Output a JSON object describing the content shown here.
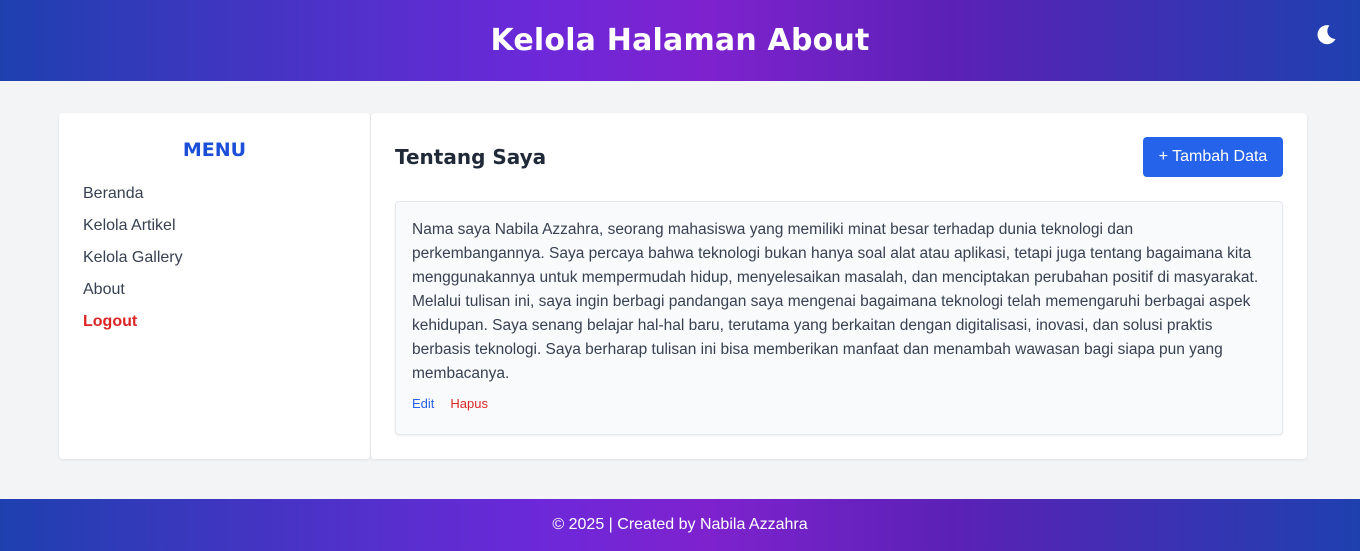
{
  "header": {
    "title": "Kelola Halaman About",
    "theme_icon": "moon-icon"
  },
  "sidebar": {
    "heading": "MENU",
    "items": [
      {
        "label": "Beranda"
      },
      {
        "label": "Kelola Artikel"
      },
      {
        "label": "Kelola Gallery"
      },
      {
        "label": "About"
      },
      {
        "label": "Logout"
      }
    ]
  },
  "main": {
    "title": "Tentang Saya",
    "add_button": "+ Tambah Data",
    "entry": {
      "text": "Nama saya Nabila Azzahra, seorang mahasiswa yang memiliki minat besar terhadap dunia teknologi dan perkembangannya. Saya percaya bahwa teknologi bukan hanya soal alat atau aplikasi, tetapi juga tentang bagaimana kita menggunakannya untuk mempermudah hidup, menyelesaikan masalah, dan menciptakan perubahan positif di masyarakat. Melalui tulisan ini, saya ingin berbagi pandangan saya mengenai bagaimana teknologi telah memengaruhi berbagai aspek kehidupan. Saya senang belajar hal-hal baru, terutama yang berkaitan dengan digitalisasi, inovasi, dan solusi praktis berbasis teknologi. Saya berharap tulisan ini bisa memberikan manfaat dan menambah wawasan bagi siapa pun yang membacanya.",
      "edit_label": "Edit",
      "delete_label": "Hapus"
    }
  },
  "footer": {
    "text": "© 2025 | Created by Nabila Azzahra"
  },
  "colors": {
    "accent": "#2563eb",
    "menu_heading": "#1d4ed8",
    "danger": "#dc2626",
    "gradient_mid": "#7e22ce",
    "gradient_edge": "#1e40af"
  }
}
